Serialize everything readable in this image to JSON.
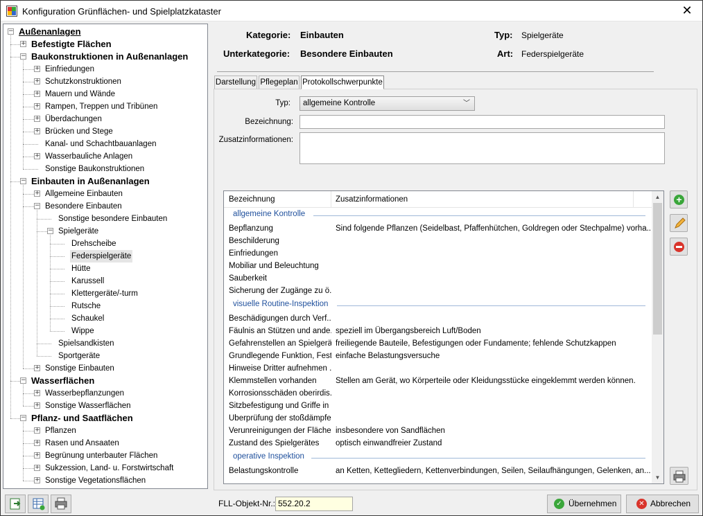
{
  "window": {
    "title": "Konfiguration Grünflächen- und Spielplatzkataster"
  },
  "tree": [
    {
      "label": "Außenanlagen",
      "level": 0,
      "expander": "minus"
    },
    {
      "label": "Befestigte Flächen",
      "level": 1,
      "expander": "plus"
    },
    {
      "label": "Baukonstruktionen in Außenanlagen",
      "level": 1,
      "expander": "minus"
    },
    {
      "label": "Einfriedungen",
      "level": 2,
      "expander": "plus"
    },
    {
      "label": "Schutzkonstruktionen",
      "level": 2,
      "expander": "plus"
    },
    {
      "label": "Mauern und Wände",
      "level": 2,
      "expander": "plus"
    },
    {
      "label": "Rampen, Treppen und Tribünen",
      "level": 2,
      "expander": "plus"
    },
    {
      "label": "Überdachungen",
      "level": 2,
      "expander": "plus"
    },
    {
      "label": "Brücken und Stege",
      "level": 2,
      "expander": "plus"
    },
    {
      "label": "Kanal- und Schachtbauanlagen",
      "level": 2,
      "expander": "none"
    },
    {
      "label": "Wasserbauliche Anlagen",
      "level": 2,
      "expander": "plus"
    },
    {
      "label": "Sonstige Baukonstruktionen",
      "level": 2,
      "expander": "none"
    },
    {
      "label": "Einbauten in Außenanlagen",
      "level": 1,
      "expander": "minus"
    },
    {
      "label": "Allgemeine Einbauten",
      "level": 2,
      "expander": "plus"
    },
    {
      "label": "Besondere Einbauten",
      "level": 2,
      "expander": "minus"
    },
    {
      "label": "Sonstige besondere Einbauten",
      "level": 3,
      "expander": "none"
    },
    {
      "label": "Spielgeräte",
      "level": 3,
      "expander": "minus"
    },
    {
      "label": "Drehscheibe",
      "level": 4,
      "expander": "none"
    },
    {
      "label": "Federspielgeräte",
      "level": 4,
      "expander": "none",
      "selected": true
    },
    {
      "label": "Hütte",
      "level": 4,
      "expander": "none"
    },
    {
      "label": "Karussell",
      "level": 4,
      "expander": "none"
    },
    {
      "label": "Klettergeräte/-turm",
      "level": 4,
      "expander": "none"
    },
    {
      "label": "Rutsche",
      "level": 4,
      "expander": "none"
    },
    {
      "label": "Schaukel",
      "level": 4,
      "expander": "none"
    },
    {
      "label": "Wippe",
      "level": 4,
      "expander": "none"
    },
    {
      "label": "Spielsandkisten",
      "level": 3,
      "expander": "none"
    },
    {
      "label": "Sportgeräte",
      "level": 3,
      "expander": "none"
    },
    {
      "label": "Sonstige Einbauten",
      "level": 2,
      "expander": "plus"
    },
    {
      "label": "Wasserflächen",
      "level": 1,
      "expander": "minus"
    },
    {
      "label": "Wasserbepflanzungen",
      "level": 2,
      "expander": "plus"
    },
    {
      "label": "Sonstige Wasserflächen",
      "level": 2,
      "expander": "plus"
    },
    {
      "label": "Pflanz- und Saatflächen",
      "level": 1,
      "expander": "minus"
    },
    {
      "label": "Pflanzen",
      "level": 2,
      "expander": "plus"
    },
    {
      "label": "Rasen und Ansaaten",
      "level": 2,
      "expander": "plus"
    },
    {
      "label": "Begrünung unterbauter Flächen",
      "level": 2,
      "expander": "plus"
    },
    {
      "label": "Sukzession, Land- u. Forstwirtschaft",
      "level": 2,
      "expander": "plus"
    },
    {
      "label": "Sonstige Vegetationsflächen",
      "level": 2,
      "expander": "plus"
    }
  ],
  "header": {
    "kategorie_label": "Kategorie:",
    "kategorie_value": "Einbauten",
    "typ_label": "Typ:",
    "typ_value": "Spielgeräte",
    "unterkategorie_label": "Unterkategorie:",
    "unterkategorie_value": "Besondere Einbauten",
    "art_label": "Art:",
    "art_value": "Federspielgeräte"
  },
  "tabs": [
    "Darstellung",
    "Pflegeplan",
    "Protokollschwerpunkte"
  ],
  "active_tab": "Protokollschwerpunkte",
  "form": {
    "typ_label": "Typ:",
    "typ_value": "allgemeine Kontrolle",
    "bezeichnung_label": "Bezeichnung:",
    "bezeichnung_value": "",
    "zusatz_label": "Zusatzinformationen:",
    "zusatz_value": ""
  },
  "grid": {
    "columns": [
      "Bezeichnung",
      "Zusatzinformationen"
    ],
    "groups": [
      {
        "name": "allgemeine Kontrolle",
        "rows": [
          [
            "Bepflanzung",
            "Sind folgende Pflanzen (Seidelbast, Pfaffenhütchen, Goldregen oder Stechpalme) vorha..."
          ],
          [
            "Beschilderung",
            ""
          ],
          [
            "Einfriedungen",
            ""
          ],
          [
            "Mobiliar und Beleuchtung",
            ""
          ],
          [
            "Sauberkeit",
            ""
          ],
          [
            "Sicherung der Zugänge zu ö...",
            ""
          ]
        ]
      },
      {
        "name": "visuelle Routine-Inspektion",
        "rows": [
          [
            "Beschädigungen durch Verf...",
            ""
          ],
          [
            "Fäulnis an Stützen und ande...",
            "speziell im Übergangsbereich Luft/Boden"
          ],
          [
            "Gefahrenstellen an Spielgerä...",
            "freiliegende Bauteile, Befestigungen oder Fundamente; fehlende Schutzkappen"
          ],
          [
            "Grundlegende Funktion, Fest...",
            "einfache Belastungsversuche"
          ],
          [
            "Hinweise Dritter aufnehmen ...",
            ""
          ],
          [
            "Klemmstellen vorhanden",
            "Stellen am Gerät, wo Körperteile oder Kleidungsstücke eingeklemmt werden können."
          ],
          [
            "Korrosionsschäden oberirdis...",
            ""
          ],
          [
            "Sitzbefestigung und Griffe in ...",
            ""
          ],
          [
            "Überprüfung der stoßdämpfe...",
            ""
          ],
          [
            "Verunreinigungen der Fläche...",
            "insbesondere von Sandflächen"
          ],
          [
            "Zustand des Spielgerätes",
            "optisch einwandfreier Zustand"
          ]
        ]
      },
      {
        "name": "operative Inspektion",
        "rows": [
          [
            "Belastungskontrolle",
            "an Ketten, Kettegliedern, Kettenverbindungen, Seilen, Seilaufhängungen, Gelenken, an..."
          ]
        ]
      }
    ]
  },
  "side_buttons": [
    "add-icon",
    "edit-icon",
    "delete-icon",
    "print-icon"
  ],
  "footer": {
    "fll_label": "FLL-Objekt-Nr.:",
    "fll_value": "552.20.2",
    "ok_label": "Übernehmen",
    "cancel_label": "Abbrechen"
  },
  "colors": {
    "group_text": "#1e4f9c",
    "selected_bg": "#e5e5e5",
    "fll_bg": "#ffffe1"
  }
}
